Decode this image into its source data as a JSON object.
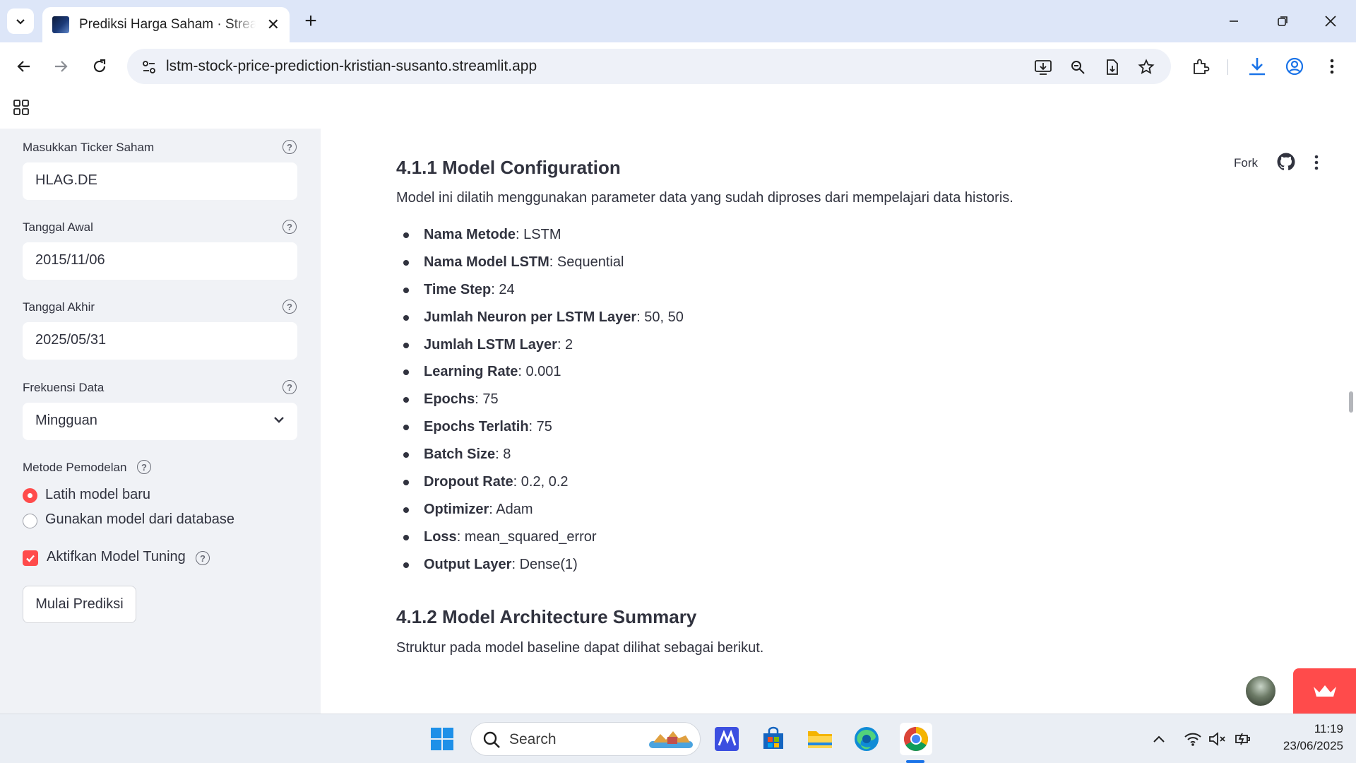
{
  "browser": {
    "tab_title": "Prediksi Harga Saham · Streamlit",
    "url": "lstm-stock-price-prediction-kristian-susanto.streamlit.app"
  },
  "sidebar": {
    "ticker": {
      "label": "Masukkan Ticker Saham",
      "value": "HLAG.DE"
    },
    "start_date": {
      "label": "Tanggal Awal",
      "value": "2015/11/06"
    },
    "end_date": {
      "label": "Tanggal Akhir",
      "value": "2025/05/31"
    },
    "frequency": {
      "label": "Frekuensi Data",
      "value": "Mingguan"
    },
    "method": {
      "label": "Metode Pemodelan",
      "options": [
        "Latih model baru",
        "Gunakan model dari database"
      ],
      "selected": "Latih model baru"
    },
    "tuning": {
      "label": "Aktifkan Model Tuning",
      "checked": true
    },
    "predict_button": "Mulai Prediksi"
  },
  "header": {
    "fork_label": "Fork"
  },
  "content": {
    "section1_title": "4.1.1 Model Configuration",
    "section1_intro": "Model ini dilatih menggunakan parameter data yang sudah diproses dari mempelajari data historis.",
    "config_items": [
      {
        "key": "Nama Metode",
        "value": ": LSTM"
      },
      {
        "key": "Nama Model LSTM",
        "value": ": Sequential"
      },
      {
        "key": "Time Step",
        "value": ": 24"
      },
      {
        "key": "Jumlah Neuron per LSTM Layer",
        "value": ": 50, 50"
      },
      {
        "key": "Jumlah LSTM Layer",
        "value": ": 2"
      },
      {
        "key": "Learning Rate",
        "value": ": 0.001"
      },
      {
        "key": "Epochs",
        "value": ": 75"
      },
      {
        "key": "Epochs Terlatih",
        "value": ": 75"
      },
      {
        "key": "Batch Size",
        "value": ": 8"
      },
      {
        "key": "Dropout Rate",
        "value": ": 0.2, 0.2"
      },
      {
        "key": "Optimizer",
        "value": ": Adam"
      },
      {
        "key": "Loss",
        "value": ": mean_squared_error"
      },
      {
        "key": "Output Layer",
        "value": ": Dense(1)"
      }
    ],
    "section2_title": "4.1.2 Model Architecture Summary",
    "section2_intro": "Struktur pada model baseline dapat dilihat sebagai berikut."
  },
  "taskbar": {
    "search_label": "Search",
    "time": "11:19",
    "date": "23/06/2025"
  },
  "colors": {
    "accent": "#ff4b4b",
    "sidebar_bg": "#f0f2f6",
    "text": "#31333f",
    "tabstrip": "#dde6f8"
  }
}
